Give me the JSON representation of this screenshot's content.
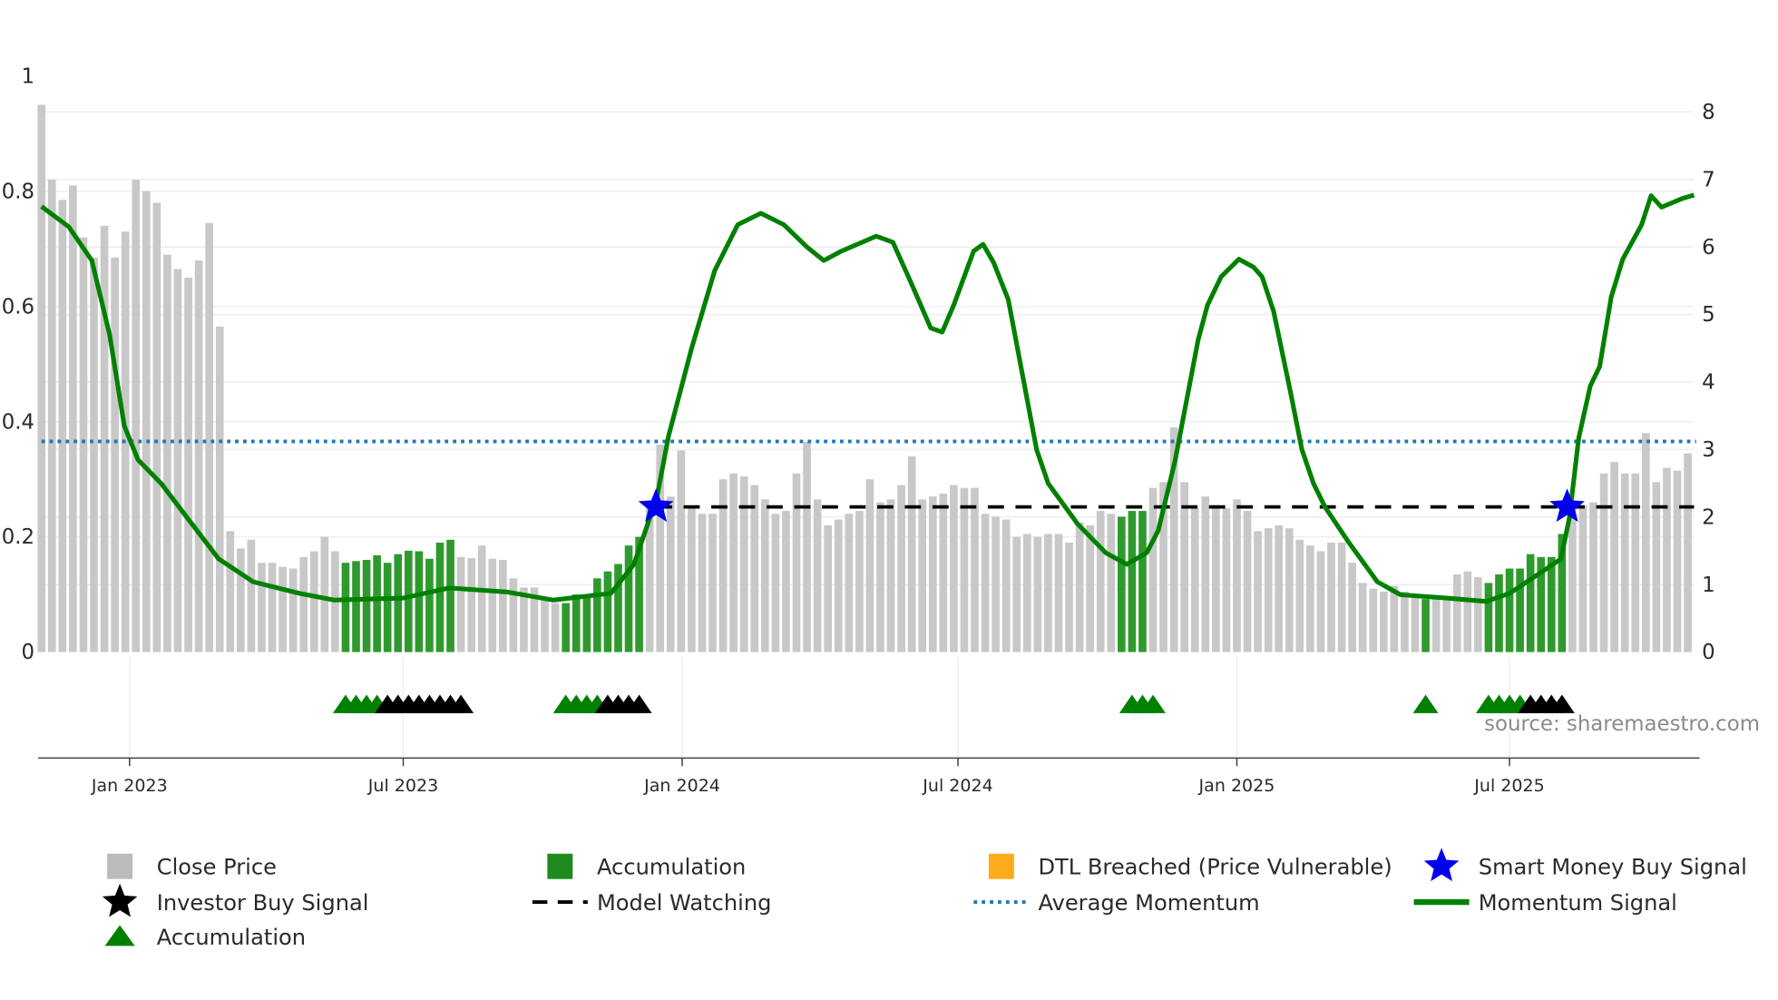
{
  "chart_data": {
    "type": "bar",
    "title": "",
    "xlabel": "",
    "ylabel_left": "",
    "ylabel_right": "",
    "ylim_left": [
      0,
      1
    ],
    "ylim_right": [
      0,
      8
    ],
    "left_ticks": [
      "0",
      "0.2",
      "0.4",
      "0.6",
      "0.8",
      "1"
    ],
    "left_tick_values": [
      0,
      0.2,
      0.4,
      0.6,
      0.8,
      1
    ],
    "right_ticks": [
      "0",
      "1",
      "2",
      "3",
      "4",
      "5",
      "6",
      "7",
      "8"
    ],
    "right_tick_values": [
      0,
      1,
      2,
      3,
      4,
      5,
      6,
      7,
      8
    ],
    "x_ticks": [
      {
        "label": "Jan 2023",
        "index": 8.4
      },
      {
        "label": "Jul 2023",
        "index": 34.5
      },
      {
        "label": "Jan 2024",
        "index": 61.1
      },
      {
        "label": "Jul 2024",
        "index": 87.4
      },
      {
        "label": "Jan 2025",
        "index": 114
      },
      {
        "label": "Jul 2025",
        "index": 140
      }
    ],
    "close_price": [
      0.95,
      0.82,
      0.785,
      0.81,
      0.72,
      0.685,
      0.74,
      0.685,
      0.73,
      0.82,
      0.8,
      0.78,
      0.69,
      0.665,
      0.65,
      0.68,
      0.745,
      0.565,
      0.21,
      0.18,
      0.195,
      0.155,
      0.155,
      0.148,
      0.145,
      0.165,
      0.175,
      0.2,
      0.175,
      0.155,
      0.158,
      0.16,
      0.168,
      0.155,
      0.17,
      0.176,
      0.175,
      0.162,
      0.19,
      0.195,
      0.165,
      0.163,
      0.185,
      0.162,
      0.16,
      0.128,
      0.112,
      0.112,
      0.09,
      0.085,
      0.085,
      0.1,
      0.1,
      0.128,
      0.14,
      0.153,
      0.185,
      0.2,
      0.25,
      0.36,
      0.27,
      0.35,
      0.25,
      0.24,
      0.24,
      0.3,
      0.31,
      0.305,
      0.29,
      0.265,
      0.24,
      0.245,
      0.31,
      0.365,
      0.265,
      0.22,
      0.23,
      0.24,
      0.245,
      0.3,
      0.26,
      0.265,
      0.29,
      0.34,
      0.265,
      0.27,
      0.275,
      0.29,
      0.285,
      0.285,
      0.24,
      0.235,
      0.23,
      0.2,
      0.205,
      0.2,
      0.205,
      0.205,
      0.19,
      0.225,
      0.22,
      0.245,
      0.24,
      0.235,
      0.245,
      0.245,
      0.285,
      0.295,
      0.39,
      0.295,
      0.25,
      0.27,
      0.255,
      0.25,
      0.265,
      0.245,
      0.21,
      0.215,
      0.22,
      0.215,
      0.195,
      0.185,
      0.175,
      0.19,
      0.19,
      0.155,
      0.12,
      0.11,
      0.105,
      0.115,
      0.105,
      0.1,
      0.092,
      0.093,
      0.095,
      0.135,
      0.14,
      0.13,
      0.12,
      0.135,
      0.145,
      0.145,
      0.17,
      0.165,
      0.165,
      0.205,
      0.25,
      0.255,
      0.26,
      0.31,
      0.33,
      0.31,
      0.31,
      0.38,
      0.295,
      0.32,
      0.315,
      0.345
    ],
    "accumulation_bar_indices": [
      29,
      30,
      31,
      32,
      33,
      34,
      35,
      36,
      37,
      38,
      39,
      50,
      51,
      52,
      53,
      54,
      55,
      56,
      57,
      103,
      104,
      105,
      132,
      138,
      139,
      140,
      141,
      142,
      143,
      144,
      145
    ],
    "momentum_signal": [
      [
        0,
        6.6
      ],
      [
        2.6,
        6.3
      ],
      [
        4.8,
        5.8
      ],
      [
        6.5,
        4.7
      ],
      [
        7.9,
        3.35
      ],
      [
        9.2,
        2.85
      ],
      [
        11.4,
        2.5
      ],
      [
        13.6,
        2.05
      ],
      [
        16.9,
        1.38
      ],
      [
        20.2,
        1.04
      ],
      [
        24.6,
        0.87
      ],
      [
        27.9,
        0.77
      ],
      [
        34.5,
        0.8
      ],
      [
        38.9,
        0.95
      ],
      [
        44.4,
        0.89
      ],
      [
        48.8,
        0.77
      ],
      [
        54.3,
        0.87
      ],
      [
        56.5,
        1.3
      ],
      [
        58.7,
        2.3
      ],
      [
        59.8,
        3.2
      ],
      [
        62,
        4.5
      ],
      [
        64.2,
        5.65
      ],
      [
        66.4,
        6.33
      ],
      [
        68.6,
        6.5
      ],
      [
        70.8,
        6.33
      ],
      [
        73,
        6.0
      ],
      [
        74.6,
        5.8
      ],
      [
        76.3,
        5.94
      ],
      [
        79.6,
        6.16
      ],
      [
        81.2,
        6.07
      ],
      [
        82.9,
        5.48
      ],
      [
        84.8,
        4.8
      ],
      [
        85.9,
        4.74
      ],
      [
        87,
        5.14
      ],
      [
        88.9,
        5.94
      ],
      [
        89.8,
        6.04
      ],
      [
        90.8,
        5.77
      ],
      [
        92.2,
        5.22
      ],
      [
        94.9,
        3.0
      ],
      [
        96,
        2.5
      ],
      [
        98.8,
        1.9
      ],
      [
        101.5,
        1.47
      ],
      [
        103.5,
        1.3
      ],
      [
        105.4,
        1.47
      ],
      [
        106.5,
        1.8
      ],
      [
        108.1,
        2.83
      ],
      [
        110.3,
        4.62
      ],
      [
        111.2,
        5.14
      ],
      [
        112.5,
        5.56
      ],
      [
        114.2,
        5.82
      ],
      [
        115.6,
        5.7
      ],
      [
        116.4,
        5.56
      ],
      [
        117.5,
        5.05
      ],
      [
        119.1,
        3.86
      ],
      [
        120.2,
        3.0
      ],
      [
        121.3,
        2.5
      ],
      [
        122.4,
        2.15
      ],
      [
        124.6,
        1.64
      ],
      [
        127.4,
        1.04
      ],
      [
        129.6,
        0.85
      ],
      [
        134,
        0.8
      ],
      [
        137.8,
        0.75
      ],
      [
        140,
        0.87
      ],
      [
        143.3,
        1.21
      ],
      [
        144.9,
        1.38
      ],
      [
        145.7,
        1.98
      ],
      [
        146.6,
        3.17
      ],
      [
        147.7,
        3.94
      ],
      [
        148.6,
        4.23
      ],
      [
        149.7,
        5.26
      ],
      [
        150.8,
        5.82
      ],
      [
        152.6,
        6.33
      ],
      [
        153.5,
        6.76
      ],
      [
        154.5,
        6.59
      ],
      [
        156.5,
        6.72
      ],
      [
        157.6,
        6.77
      ]
    ],
    "average_momentum": 3.12,
    "model_watching": {
      "value": 2.15,
      "from_index": 58.6,
      "to_index": 157.6
    },
    "smart_money_buy_signals": [
      [
        58.6,
        2.15
      ],
      [
        145.5,
        2.15
      ]
    ],
    "accumulation_triangles": [
      29,
      30,
      31,
      32,
      50,
      51,
      52,
      53,
      104,
      105,
      106,
      132,
      138,
      139,
      140,
      141
    ],
    "investor_buy_triangles": [
      33,
      34,
      35,
      36,
      37,
      38,
      39,
      40,
      54,
      55,
      56,
      57,
      142,
      143,
      144,
      145
    ],
    "source_note": "source: sharemaestro.com",
    "legend_position": "bottom",
    "legend": [
      {
        "label": "Close Price",
        "symbol": "square",
        "color": "#bbbbbb"
      },
      {
        "label": "Accumulation",
        "symbol": "square",
        "color": "#1f8b1f"
      },
      {
        "label": "DTL Breached (Price Vulnerable)",
        "symbol": "square",
        "color": "#ffab1a"
      },
      {
        "label": "Smart Money Buy Signal",
        "symbol": "star",
        "color": "#0000ee"
      },
      {
        "label": "Investor Buy Signal",
        "symbol": "star",
        "color": "#000000"
      },
      {
        "label": "Model Watching",
        "symbol": "dash",
        "color": "#000000"
      },
      {
        "label": "Average Momentum",
        "symbol": "dot",
        "color": "#1f77b4"
      },
      {
        "label": "Momentum Signal",
        "symbol": "line",
        "color": "#008000"
      },
      {
        "label": "Accumulation",
        "symbol": "triangle",
        "color": "#008000"
      }
    ],
    "colors": {
      "price": "#c8c8c8",
      "accumulation": "#2e9a2e",
      "momentum": "#008000",
      "avg": "#1f77b4",
      "watch": "#000000",
      "star": "#0000ee",
      "grid": "#eceff4"
    }
  }
}
